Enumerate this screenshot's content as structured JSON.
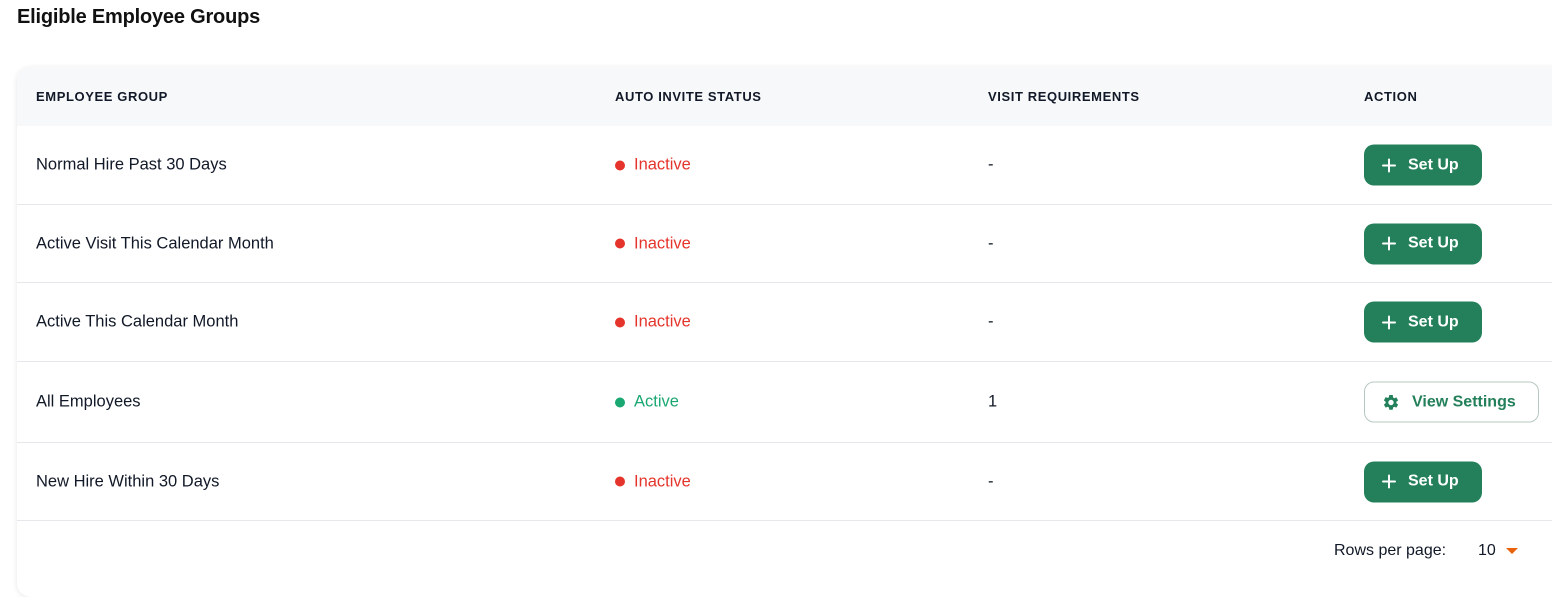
{
  "page": {
    "title": "Eligible Employee Groups"
  },
  "table": {
    "headers": [
      "EMPLOYEE GROUP",
      "AUTO INVITE STATUS",
      "VISIT REQUIREMENTS",
      "ACTION"
    ],
    "rows": [
      {
        "group": "Normal Hire Past 30 Days",
        "status": "Inactive",
        "requirements": "-",
        "action": "Set Up"
      },
      {
        "group": "Active Visit This Calendar Month",
        "status": "Inactive",
        "requirements": "-",
        "action": "Set Up"
      },
      {
        "group": "Active This Calendar Month",
        "status": "Inactive",
        "requirements": "-",
        "action": "Set Up"
      },
      {
        "group": "All Employees",
        "status": "Active",
        "requirements": "1",
        "action": "View Settings"
      },
      {
        "group": "New Hire Within 30 Days",
        "status": "Inactive",
        "requirements": "-",
        "action": "Set Up"
      }
    ]
  },
  "pagination": {
    "rows_per_page_label": "Rows per page:",
    "rows_per_page_value": "10"
  },
  "colors": {
    "inactive": "#e5342b",
    "active": "#1aa872",
    "primary_green": "#23805a",
    "caret": "#e8620c"
  },
  "icons": {
    "setup": "plus-icon",
    "view_settings": "gear-icon",
    "rows_dropdown": "caret-down-icon"
  }
}
